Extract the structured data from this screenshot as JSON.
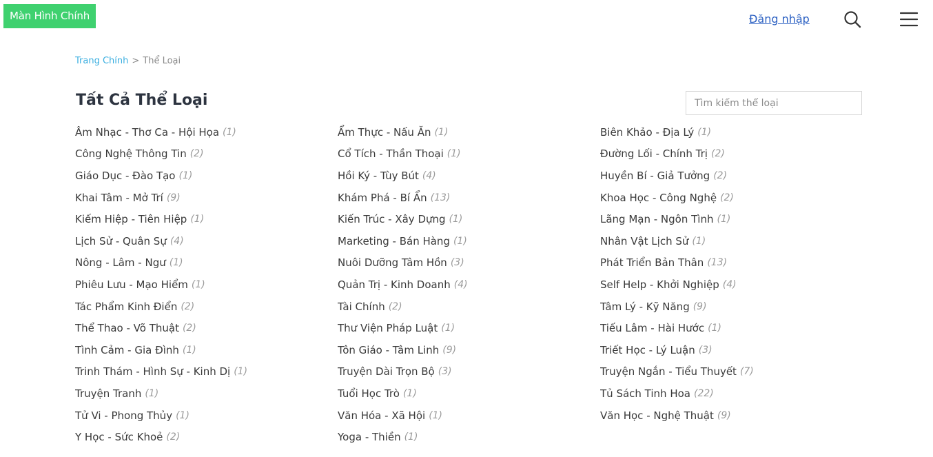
{
  "header": {
    "logo_text": "Màn Hình Chính",
    "login_label": "Đăng nhập",
    "icons": {
      "search": "search-icon",
      "menu": "hamburger-menu-icon"
    }
  },
  "breadcrumb": {
    "home": "Trang Chính",
    "separator": ">",
    "current": "Thể Loại"
  },
  "page": {
    "title": "Tất Cả Thể Loại",
    "search_placeholder": "Tìm kiếm thể loại"
  },
  "colors": {
    "logo_bg": "#3fd16f",
    "link": "#3aaee0",
    "login": "#2a5fc2"
  },
  "genres": [
    {
      "name": "Âm Nhạc - Thơ Ca - Hội Họa",
      "count": "(1)"
    },
    {
      "name": "Ẩm Thực - Nấu Ăn",
      "count": "(1)"
    },
    {
      "name": "Biên Khảo - Địa Lý",
      "count": "(1)"
    },
    {
      "name": "Công Nghệ Thông Tin",
      "count": "(2)"
    },
    {
      "name": "Cổ Tích - Thần Thoại",
      "count": "(1)"
    },
    {
      "name": "Đường Lối - Chính Trị",
      "count": "(2)"
    },
    {
      "name": "Giáo Dục - Đào Tạo",
      "count": "(1)"
    },
    {
      "name": "Hồi Ký - Tùy Bút",
      "count": "(4)"
    },
    {
      "name": "Huyền Bí - Giả Tưởng",
      "count": "(2)"
    },
    {
      "name": "Khai Tâm - Mở Trí",
      "count": "(9)"
    },
    {
      "name": "Khám Phá - Bí Ẩn",
      "count": "(13)"
    },
    {
      "name": "Khoa Học - Công Nghệ",
      "count": "(2)"
    },
    {
      "name": "Kiếm Hiệp - Tiên Hiệp",
      "count": "(1)"
    },
    {
      "name": "Kiến Trúc - Xây Dựng",
      "count": "(1)"
    },
    {
      "name": "Lãng Mạn - Ngôn Tình",
      "count": "(1)"
    },
    {
      "name": "Lịch Sử - Quân Sự",
      "count": "(4)"
    },
    {
      "name": "Marketing - Bán Hàng",
      "count": "(1)"
    },
    {
      "name": "Nhân Vật Lịch Sử",
      "count": "(1)"
    },
    {
      "name": "Nông - Lâm - Ngư",
      "count": "(1)"
    },
    {
      "name": "Nuôi Dưỡng Tâm Hồn",
      "count": "(3)"
    },
    {
      "name": "Phát Triển Bản Thân",
      "count": "(13)"
    },
    {
      "name": "Phiêu Lưu - Mạo Hiểm",
      "count": "(1)"
    },
    {
      "name": "Quản Trị - Kinh Doanh",
      "count": "(4)"
    },
    {
      "name": "Self Help - Khởi Nghiệp",
      "count": "(4)"
    },
    {
      "name": "Tác Phẩm Kinh Điển",
      "count": "(2)"
    },
    {
      "name": "Tài Chính",
      "count": "(2)"
    },
    {
      "name": "Tâm Lý - Kỹ Năng",
      "count": "(9)"
    },
    {
      "name": "Thể Thao - Võ Thuật",
      "count": "(2)"
    },
    {
      "name": "Thư Viện Pháp Luật",
      "count": "(1)"
    },
    {
      "name": "Tiếu Lâm - Hài Hước",
      "count": "(1)"
    },
    {
      "name": "Tình Cảm - Gia Đình",
      "count": "(1)"
    },
    {
      "name": "Tôn Giáo - Tâm Linh",
      "count": "(9)"
    },
    {
      "name": "Triết Học - Lý Luận",
      "count": "(3)"
    },
    {
      "name": "Trinh Thám - Hình Sự - Kinh Dị",
      "count": "(1)"
    },
    {
      "name": "Truyện Dài Trọn Bộ",
      "count": "(3)"
    },
    {
      "name": "Truyện Ngắn - Tiểu Thuyết",
      "count": "(7)"
    },
    {
      "name": "Truyện Tranh",
      "count": "(1)"
    },
    {
      "name": "Tuổi Học Trò",
      "count": "(1)"
    },
    {
      "name": "Tủ Sách Tinh Hoa",
      "count": "(22)"
    },
    {
      "name": "Tử Vi - Phong Thủy",
      "count": "(1)"
    },
    {
      "name": "Văn Hóa - Xã Hội",
      "count": "(1)"
    },
    {
      "name": "Văn Học - Nghệ Thuật",
      "count": "(9)"
    },
    {
      "name": "Y Học - Sức Khoẻ",
      "count": "(2)"
    },
    {
      "name": "Yoga - Thiền",
      "count": "(1)"
    }
  ]
}
